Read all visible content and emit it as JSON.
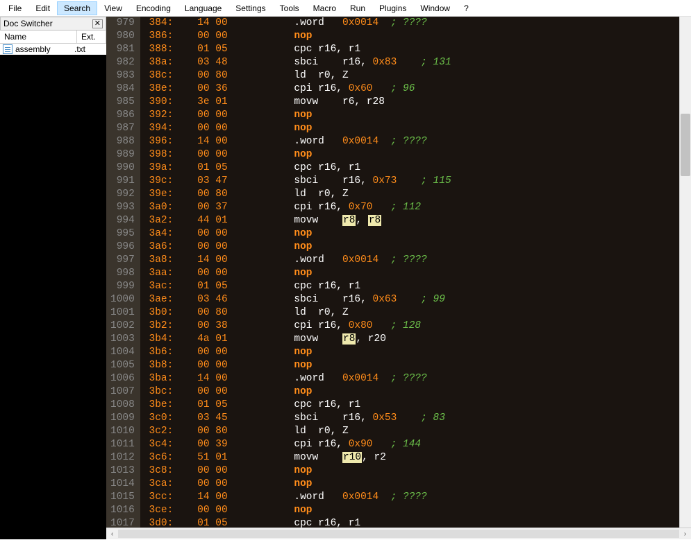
{
  "menu": {
    "items": [
      "File",
      "Edit",
      "Search",
      "View",
      "Encoding",
      "Language",
      "Settings",
      "Tools",
      "Macro",
      "Run",
      "Plugins",
      "Window",
      "?"
    ],
    "active_index": 2
  },
  "sidebar": {
    "title": "Doc Switcher",
    "columns": {
      "name": "Name",
      "ext": "Ext."
    },
    "files": [
      {
        "name": "assembly",
        "ext": ".txt"
      }
    ]
  },
  "editor": {
    "lines": [
      {
        "num": "979",
        "addr": "384:",
        "hex": "14 00",
        "tokens": [
          {
            "t": "instr",
            "v": ".word"
          },
          {
            "sp": 3
          },
          {
            "t": "num",
            "v": "0x0014"
          },
          {
            "sp": 2
          },
          {
            "t": "comment",
            "v": "; ????"
          }
        ]
      },
      {
        "num": "980",
        "addr": "386:",
        "hex": "00 00",
        "tokens": [
          {
            "t": "nop",
            "v": "nop"
          }
        ]
      },
      {
        "num": "981",
        "addr": "388:",
        "hex": "01 05",
        "tokens": [
          {
            "t": "instr",
            "v": "cpc r16, r1"
          }
        ]
      },
      {
        "num": "982",
        "addr": "38a:",
        "hex": "03 48",
        "tokens": [
          {
            "t": "instr",
            "v": "sbci"
          },
          {
            "sp": 4
          },
          {
            "t": "instr",
            "v": "r16,"
          },
          {
            "sp": 1
          },
          {
            "t": "num",
            "v": "0x83"
          },
          {
            "sp": 4
          },
          {
            "t": "comment",
            "v": "; 131"
          }
        ]
      },
      {
        "num": "983",
        "addr": "38c:",
        "hex": "00 80",
        "tokens": [
          {
            "t": "instr",
            "v": "ld  r0, Z"
          }
        ]
      },
      {
        "num": "984",
        "addr": "38e:",
        "hex": "00 36",
        "tokens": [
          {
            "t": "instr",
            "v": "cpi r16,"
          },
          {
            "sp": 1
          },
          {
            "t": "num",
            "v": "0x60"
          },
          {
            "sp": 3
          },
          {
            "t": "comment",
            "v": "; 96"
          }
        ]
      },
      {
        "num": "985",
        "addr": "390:",
        "hex": "3e 01",
        "tokens": [
          {
            "t": "instr",
            "v": "movw"
          },
          {
            "sp": 4
          },
          {
            "t": "instr",
            "v": "r6, r28"
          }
        ]
      },
      {
        "num": "986",
        "addr": "392:",
        "hex": "00 00",
        "tokens": [
          {
            "t": "nop",
            "v": "nop"
          }
        ]
      },
      {
        "num": "987",
        "addr": "394:",
        "hex": "00 00",
        "tokens": [
          {
            "t": "nop",
            "v": "nop"
          }
        ]
      },
      {
        "num": "988",
        "addr": "396:",
        "hex": "14 00",
        "tokens": [
          {
            "t": "instr",
            "v": ".word"
          },
          {
            "sp": 3
          },
          {
            "t": "num",
            "v": "0x0014"
          },
          {
            "sp": 2
          },
          {
            "t": "comment",
            "v": "; ????"
          }
        ]
      },
      {
        "num": "989",
        "addr": "398:",
        "hex": "00 00",
        "tokens": [
          {
            "t": "nop",
            "v": "nop"
          }
        ]
      },
      {
        "num": "990",
        "addr": "39a:",
        "hex": "01 05",
        "tokens": [
          {
            "t": "instr",
            "v": "cpc r16, r1"
          }
        ]
      },
      {
        "num": "991",
        "addr": "39c:",
        "hex": "03 47",
        "tokens": [
          {
            "t": "instr",
            "v": "sbci"
          },
          {
            "sp": 4
          },
          {
            "t": "instr",
            "v": "r16,"
          },
          {
            "sp": 1
          },
          {
            "t": "num",
            "v": "0x73"
          },
          {
            "sp": 4
          },
          {
            "t": "comment",
            "v": "; 115"
          }
        ]
      },
      {
        "num": "992",
        "addr": "39e:",
        "hex": "00 80",
        "tokens": [
          {
            "t": "instr",
            "v": "ld  r0, Z"
          }
        ]
      },
      {
        "num": "993",
        "addr": "3a0:",
        "hex": "00 37",
        "tokens": [
          {
            "t": "instr",
            "v": "cpi r16,"
          },
          {
            "sp": 1
          },
          {
            "t": "num",
            "v": "0x70"
          },
          {
            "sp": 3
          },
          {
            "t": "comment",
            "v": "; 112"
          }
        ]
      },
      {
        "num": "994",
        "addr": "3a2:",
        "hex": "44 01",
        "tokens": [
          {
            "t": "instr",
            "v": "movw"
          },
          {
            "sp": 4
          },
          {
            "t": "hl",
            "v": "r8"
          },
          {
            "t": "instr",
            "v": ","
          },
          {
            "sp": 1
          },
          {
            "t": "hl",
            "v": "r8"
          }
        ]
      },
      {
        "num": "995",
        "addr": "3a4:",
        "hex": "00 00",
        "tokens": [
          {
            "t": "nop",
            "v": "nop"
          }
        ]
      },
      {
        "num": "996",
        "addr": "3a6:",
        "hex": "00 00",
        "tokens": [
          {
            "t": "nop",
            "v": "nop"
          }
        ]
      },
      {
        "num": "997",
        "addr": "3a8:",
        "hex": "14 00",
        "tokens": [
          {
            "t": "instr",
            "v": ".word"
          },
          {
            "sp": 3
          },
          {
            "t": "num",
            "v": "0x0014"
          },
          {
            "sp": 2
          },
          {
            "t": "comment",
            "v": "; ????"
          }
        ]
      },
      {
        "num": "998",
        "addr": "3aa:",
        "hex": "00 00",
        "tokens": [
          {
            "t": "nop",
            "v": "nop"
          }
        ]
      },
      {
        "num": "999",
        "addr": "3ac:",
        "hex": "01 05",
        "tokens": [
          {
            "t": "instr",
            "v": "cpc r16, r1"
          }
        ]
      },
      {
        "num": "1000",
        "addr": "3ae:",
        "hex": "03 46",
        "tokens": [
          {
            "t": "instr",
            "v": "sbci"
          },
          {
            "sp": 4
          },
          {
            "t": "instr",
            "v": "r16,"
          },
          {
            "sp": 1
          },
          {
            "t": "num",
            "v": "0x63"
          },
          {
            "sp": 4
          },
          {
            "t": "comment",
            "v": "; 99"
          }
        ]
      },
      {
        "num": "1001",
        "addr": "3b0:",
        "hex": "00 80",
        "tokens": [
          {
            "t": "instr",
            "v": "ld  r0, Z"
          }
        ]
      },
      {
        "num": "1002",
        "addr": "3b2:",
        "hex": "00 38",
        "tokens": [
          {
            "t": "instr",
            "v": "cpi r16,"
          },
          {
            "sp": 1
          },
          {
            "t": "num",
            "v": "0x80"
          },
          {
            "sp": 3
          },
          {
            "t": "comment",
            "v": "; 128"
          }
        ]
      },
      {
        "num": "1003",
        "addr": "3b4:",
        "hex": "4a 01",
        "tokens": [
          {
            "t": "instr",
            "v": "movw"
          },
          {
            "sp": 4
          },
          {
            "t": "hl",
            "v": "r8"
          },
          {
            "t": "instr",
            "v": ", r20"
          }
        ]
      },
      {
        "num": "1004",
        "addr": "3b6:",
        "hex": "00 00",
        "tokens": [
          {
            "t": "nop",
            "v": "nop"
          }
        ]
      },
      {
        "num": "1005",
        "addr": "3b8:",
        "hex": "00 00",
        "tokens": [
          {
            "t": "nop",
            "v": "nop"
          }
        ]
      },
      {
        "num": "1006",
        "addr": "3ba:",
        "hex": "14 00",
        "tokens": [
          {
            "t": "instr",
            "v": ".word"
          },
          {
            "sp": 3
          },
          {
            "t": "num",
            "v": "0x0014"
          },
          {
            "sp": 2
          },
          {
            "t": "comment",
            "v": "; ????"
          }
        ]
      },
      {
        "num": "1007",
        "addr": "3bc:",
        "hex": "00 00",
        "tokens": [
          {
            "t": "nop",
            "v": "nop"
          }
        ]
      },
      {
        "num": "1008",
        "addr": "3be:",
        "hex": "01 05",
        "tokens": [
          {
            "t": "instr",
            "v": "cpc r16, r1"
          }
        ]
      },
      {
        "num": "1009",
        "addr": "3c0:",
        "hex": "03 45",
        "tokens": [
          {
            "t": "instr",
            "v": "sbci"
          },
          {
            "sp": 4
          },
          {
            "t": "instr",
            "v": "r16,"
          },
          {
            "sp": 1
          },
          {
            "t": "num",
            "v": "0x53"
          },
          {
            "sp": 4
          },
          {
            "t": "comment",
            "v": "; 83"
          }
        ]
      },
      {
        "num": "1010",
        "addr": "3c2:",
        "hex": "00 80",
        "tokens": [
          {
            "t": "instr",
            "v": "ld  r0, Z"
          }
        ]
      },
      {
        "num": "1011",
        "addr": "3c4:",
        "hex": "00 39",
        "tokens": [
          {
            "t": "instr",
            "v": "cpi r16,"
          },
          {
            "sp": 1
          },
          {
            "t": "num",
            "v": "0x90"
          },
          {
            "sp": 3
          },
          {
            "t": "comment",
            "v": "; 144"
          }
        ]
      },
      {
        "num": "1012",
        "addr": "3c6:",
        "hex": "51 01",
        "tokens": [
          {
            "t": "instr",
            "v": "movw"
          },
          {
            "sp": 4
          },
          {
            "t": "hl",
            "v": "r10"
          },
          {
            "t": "instr",
            "v": ", r2"
          }
        ]
      },
      {
        "num": "1013",
        "addr": "3c8:",
        "hex": "00 00",
        "tokens": [
          {
            "t": "nop",
            "v": "nop"
          }
        ]
      },
      {
        "num": "1014",
        "addr": "3ca:",
        "hex": "00 00",
        "tokens": [
          {
            "t": "nop",
            "v": "nop"
          }
        ]
      },
      {
        "num": "1015",
        "addr": "3cc:",
        "hex": "14 00",
        "tokens": [
          {
            "t": "instr",
            "v": ".word"
          },
          {
            "sp": 3
          },
          {
            "t": "num",
            "v": "0x0014"
          },
          {
            "sp": 2
          },
          {
            "t": "comment",
            "v": "; ????"
          }
        ]
      },
      {
        "num": "1016",
        "addr": "3ce:",
        "hex": "00 00",
        "tokens": [
          {
            "t": "nop",
            "v": "nop"
          }
        ]
      },
      {
        "num": "1017",
        "addr": "3d0:",
        "hex": "01 05",
        "tokens": [
          {
            "t": "instr",
            "v": "cpc r16, r1"
          }
        ]
      }
    ]
  }
}
